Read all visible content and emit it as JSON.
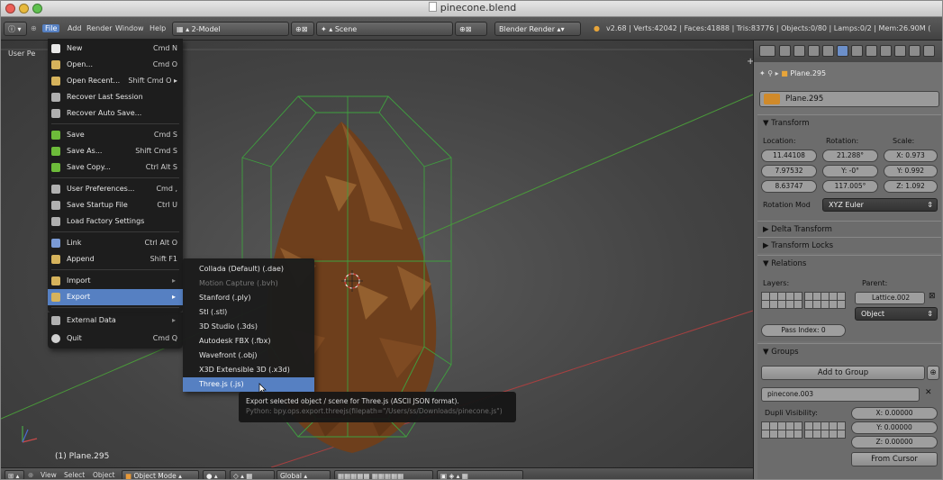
{
  "window": {
    "title": "pinecone.blend"
  },
  "infobar": {
    "file": "File",
    "add": "Add",
    "render": "Render",
    "window": "Window",
    "help": "Help",
    "screen": "2-Model",
    "scene": "Scene",
    "engine": "Blender Render",
    "stats": "v2.68 | Verts:42042 | Faces:41888 | Tris:83776 | Objects:0/80 | Lamps:0/2 | Mem:26.90M ("
  },
  "viewport": {
    "label": "User Pe",
    "object": "(1) Plane.295"
  },
  "file_menu": {
    "items": [
      {
        "label": "New",
        "shortcut": "Cmd N",
        "icon": "#e8e8e8"
      },
      {
        "label": "Open...",
        "shortcut": "Cmd O",
        "icon": "#d6b35c"
      },
      {
        "label": "Open Recent...",
        "shortcut": "Shift Cmd O",
        "arrow": "▸",
        "icon": "#d6b35c"
      },
      {
        "label": "Recover Last Session",
        "shortcut": "",
        "icon": "#b0b0b0"
      },
      {
        "label": "Recover Auto Save...",
        "shortcut": "",
        "icon": "#b0b0b0"
      },
      {
        "label": "Save",
        "shortcut": "Cmd S",
        "icon": "#6dbb3a"
      },
      {
        "label": "Save As...",
        "shortcut": "Shift Cmd S",
        "icon": "#6dbb3a"
      },
      {
        "label": "Save Copy...",
        "shortcut": "Ctrl Alt S",
        "icon": "#6dbb3a"
      },
      {
        "label": "User Preferences...",
        "shortcut": "Cmd ,",
        "icon": "#b0b0b0"
      },
      {
        "label": "Save Startup File",
        "shortcut": "Ctrl U",
        "icon": "#b0b0b0"
      },
      {
        "label": "Load Factory Settings",
        "shortcut": "",
        "icon": "#b0b0b0"
      },
      {
        "label": "Link",
        "shortcut": "Ctrl Alt O",
        "icon": "#7a9ad6"
      },
      {
        "label": "Append",
        "shortcut": "Shift F1",
        "icon": "#d6b35c"
      },
      {
        "label": "Import",
        "shortcut": "",
        "arrow": "▸",
        "icon": "#d6b35c"
      },
      {
        "label": "Export",
        "shortcut": "",
        "arrow": "▸",
        "icon": "#d6b35c"
      },
      {
        "label": "External Data",
        "shortcut": "",
        "arrow": "▸",
        "icon": "#b0b0b0"
      },
      {
        "label": "Quit",
        "shortcut": "Cmd Q",
        "icon": "#d0d0d0"
      }
    ]
  },
  "export_menu": {
    "items": [
      "Collada (Default) (.dae)",
      "Motion Capture (.bvh)",
      "Stanford (.ply)",
      "Stl (.stl)",
      "3D Studio (.3ds)",
      "Autodesk FBX (.fbx)",
      "Wavefront (.obj)",
      "X3D Extensible 3D (.x3d)",
      "Three.js (.js)"
    ]
  },
  "tooltip": {
    "line1": "Export selected object / scene for Three.js (ASCII JSON format).",
    "line2": "Python: bpy.ops.export.threejs(filepath=\"/Users/ss/Downloads/pinecone.js\")"
  },
  "bottombar": {
    "view": "View",
    "select": "Select",
    "object": "Object",
    "mode": "Object Mode",
    "orientation": "Global"
  },
  "properties": {
    "breadcrumb": "Plane.295",
    "name": "Plane.295",
    "transform": {
      "title": "Transform",
      "location_label": "Location:",
      "rotation_label": "Rotation:",
      "scale_label": "Scale:",
      "location": [
        "11.44108",
        "7.97532",
        "8.63747"
      ],
      "rotation": [
        "21.288°",
        "Y: -0°",
        "117.005°"
      ],
      "scale": [
        "X: 0.973",
        "Y: 0.992",
        "Z: 1.092"
      ],
      "rotation_mode_label": "Rotation Mod",
      "rotation_mode": "XYZ Euler"
    },
    "delta": "Delta Transform",
    "locks": "Transform Locks",
    "relations": {
      "title": "Relations",
      "layers_label": "Layers:",
      "parent_label": "Parent:",
      "parent": "Lattice.002",
      "parent_type": "Object",
      "pass_index": "Pass Index: 0"
    },
    "groups": {
      "title": "Groups",
      "add_button": "Add to Group",
      "group_name": "pinecone.003",
      "dupli_label": "Dupli Visibility:",
      "offset": [
        "X: 0.00000",
        "Y: 0.00000",
        "Z: 0.00000"
      ],
      "from_cursor": "From Cursor"
    }
  }
}
